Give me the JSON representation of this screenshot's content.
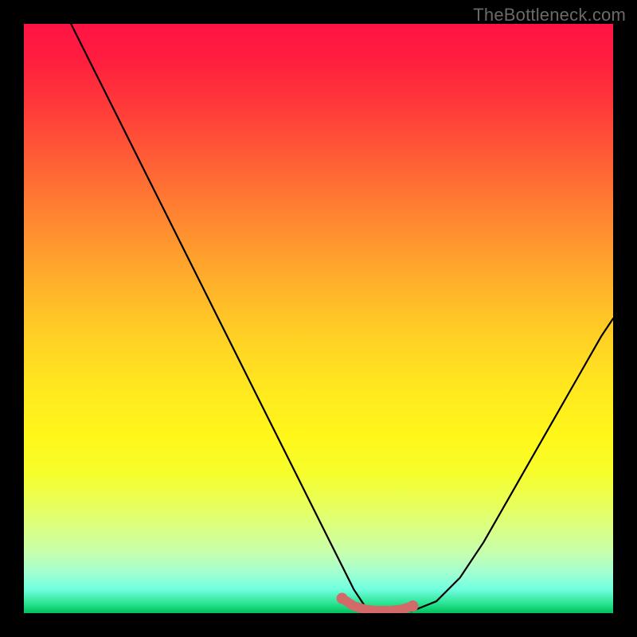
{
  "watermark": {
    "text": "TheBottleneck.com"
  },
  "colors": {
    "curve_stroke": "#000000",
    "valley_stroke": "#d36a6a",
    "gradient_top": "#ff1445",
    "gradient_bottom": "#00c05a",
    "frame": "#000000"
  },
  "chart_data": {
    "type": "line",
    "title": "",
    "xlabel": "",
    "ylabel": "",
    "xlim": [
      0,
      100
    ],
    "ylim": [
      0,
      100
    ],
    "grid": false,
    "legend": false,
    "series": [
      {
        "name": "bottleneck-curve",
        "x": [
          8,
          12,
          16,
          20,
          24,
          28,
          32,
          36,
          40,
          44,
          48,
          52,
          54,
          56,
          58,
          60,
          62,
          64,
          66,
          70,
          74,
          78,
          82,
          86,
          90,
          94,
          98,
          100
        ],
        "values": [
          100,
          92,
          84,
          76,
          68,
          60,
          52,
          44,
          36,
          28,
          20,
          12,
          8,
          4,
          1,
          0.4,
          0.2,
          0.2,
          0.4,
          2,
          6,
          12,
          19,
          26,
          33,
          40,
          47,
          50
        ]
      },
      {
        "name": "valley-highlight",
        "x": [
          54,
          56,
          58,
          60,
          62,
          64,
          66
        ],
        "values": [
          2.5,
          1.2,
          0.6,
          0.4,
          0.4,
          0.6,
          1.2
        ]
      }
    ]
  }
}
